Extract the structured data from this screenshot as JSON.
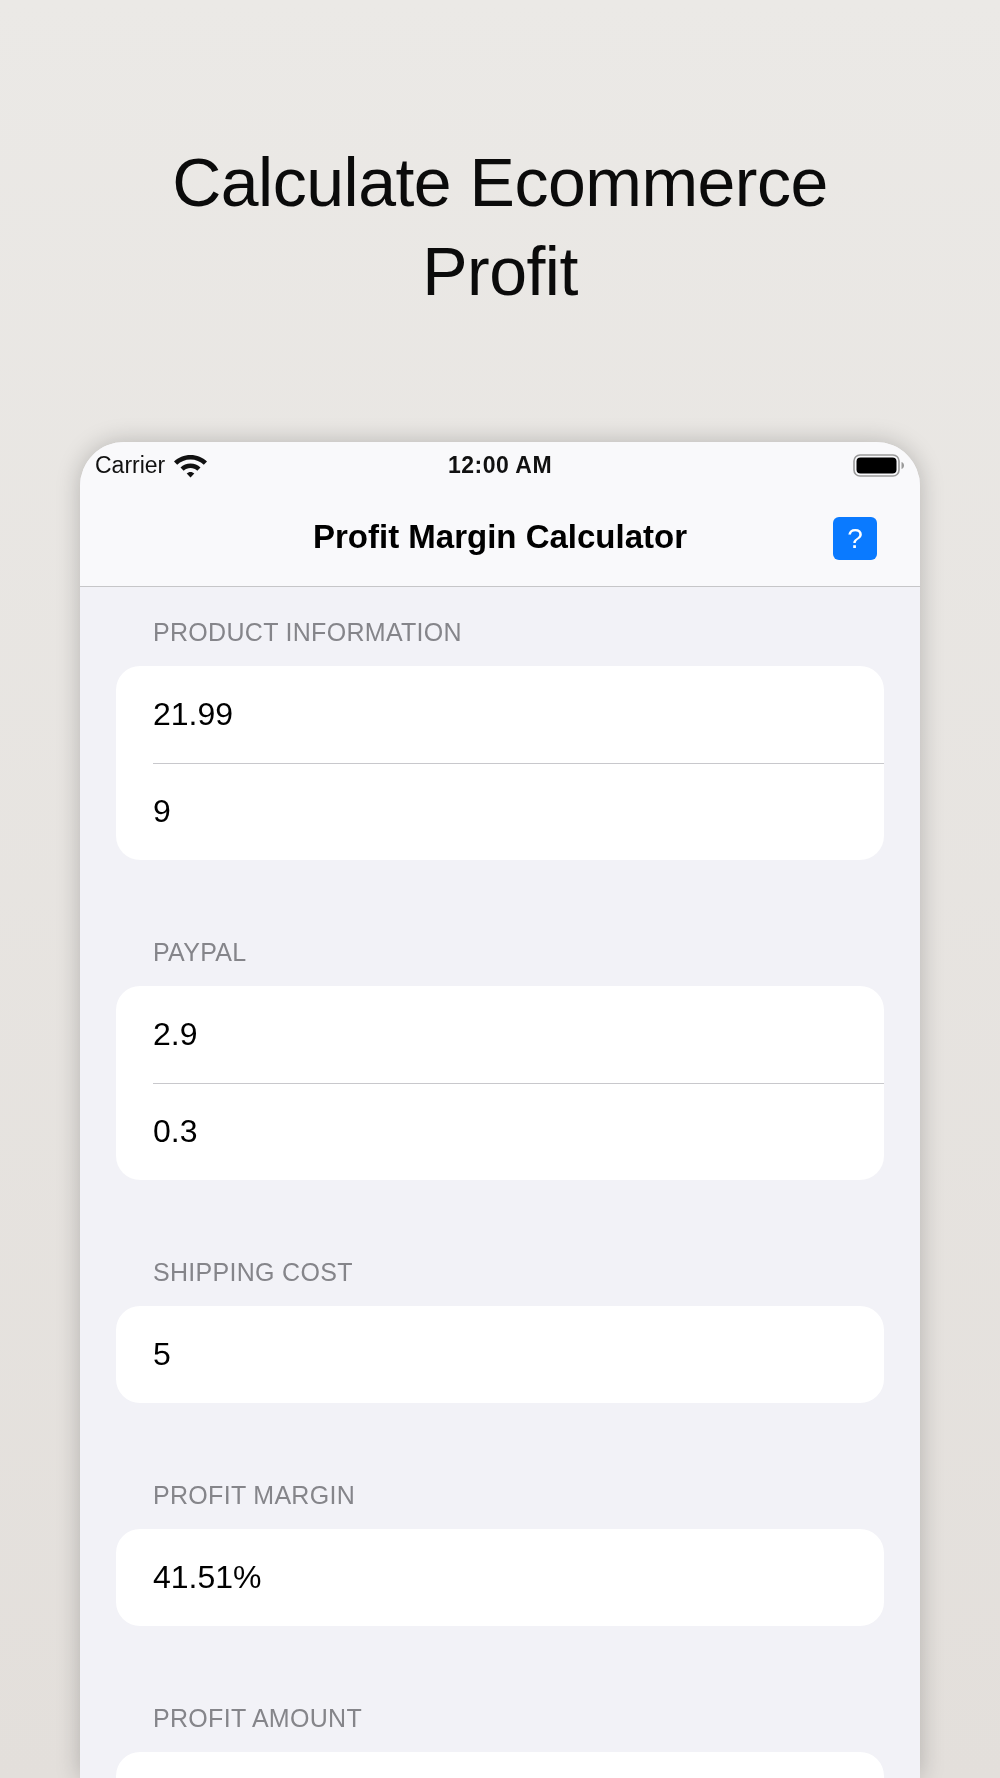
{
  "headline": "Calculate Ecommerce Profit",
  "status_bar": {
    "carrier": "Carrier",
    "time": "12:00 AM"
  },
  "nav_bar": {
    "title": "Profit Margin Calculator",
    "help_button": "?"
  },
  "sections": [
    {
      "header": "PRODUCT INFORMATION",
      "fields": [
        {
          "value": "21.99"
        },
        {
          "value": "9"
        }
      ]
    },
    {
      "header": "PAYPAL",
      "fields": [
        {
          "value": "2.9"
        },
        {
          "value": "0.3"
        }
      ]
    },
    {
      "header": "SHIPPING COST",
      "fields": [
        {
          "value": "5"
        }
      ]
    },
    {
      "header": "PROFIT MARGIN",
      "fields": [
        {
          "value": "41.51%"
        }
      ]
    },
    {
      "header": "PROFIT AMOUNT"
    }
  ]
}
